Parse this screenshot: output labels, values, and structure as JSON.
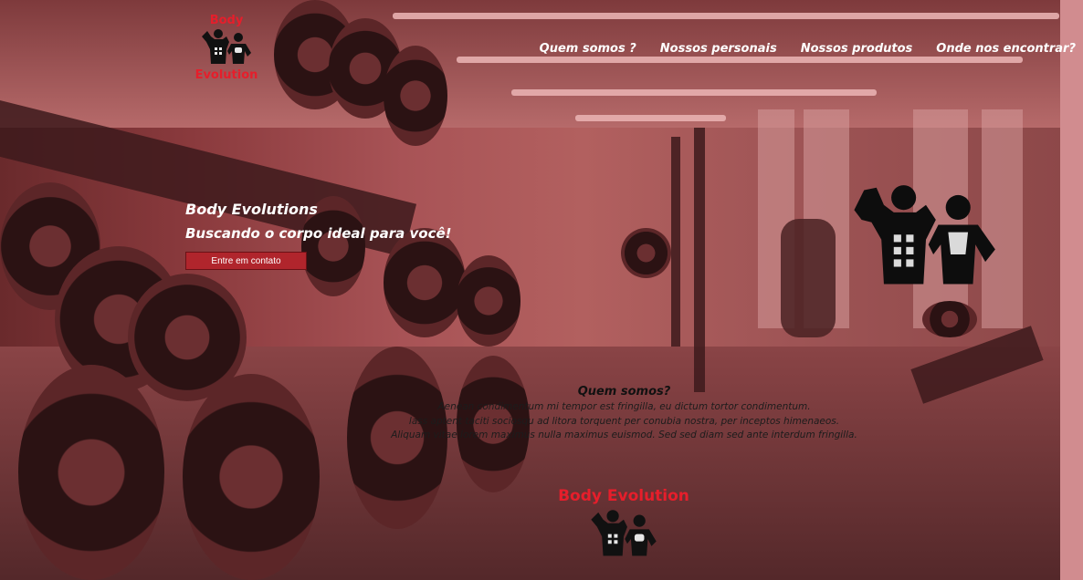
{
  "brand": {
    "logo_line1": "Body",
    "logo_line2": "Evolution",
    "footer_name": "Body Evolution",
    "accent_color": "#e61e2b"
  },
  "nav": {
    "items": [
      {
        "label": "Quem somos ?"
      },
      {
        "label": "Nossos personais"
      },
      {
        "label": "Nossos produtos"
      },
      {
        "label": "Onde nos encontrar?"
      }
    ]
  },
  "hero": {
    "title": "Body Evolutions",
    "subtitle": "Buscando o corpo ideal para você!",
    "cta_label": "Entre em contato"
  },
  "about": {
    "heading": "Quem somos?",
    "lines": [
      "Aenean condimentum mi tempor est fringilla, eu dictum tortor condimentum.",
      "lass aptent taciti sociosqu ad litora torquent per conubia nostra, per inceptos himenaeos.",
      "Aliquam vitae lorem maximus nulla maximus euismod. Sed sed diam sed ante interdum fringilla."
    ]
  },
  "icons": {
    "logo": "bodybuilder-couple-icon"
  }
}
